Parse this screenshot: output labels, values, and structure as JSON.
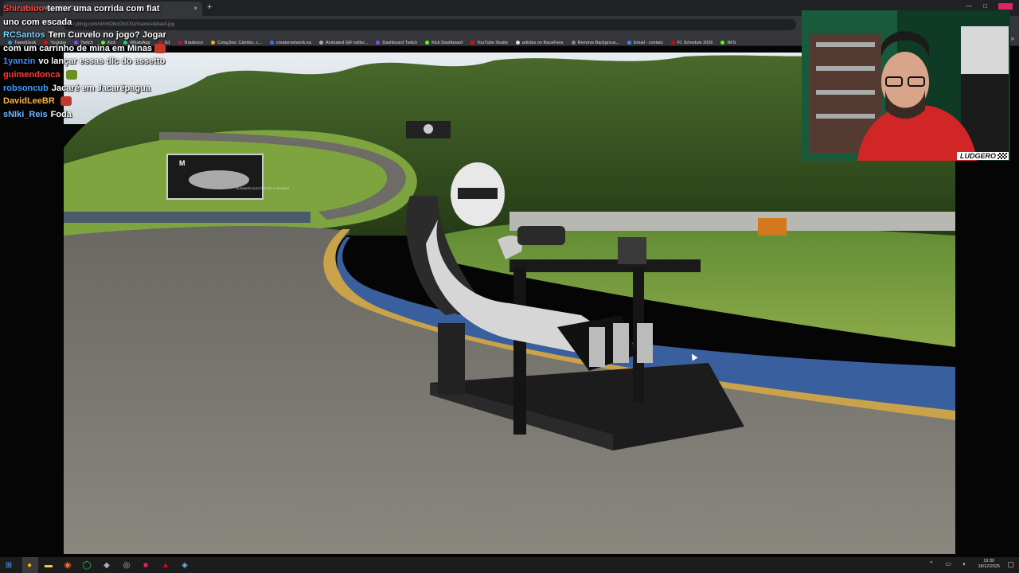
{
  "browser": {
    "tab_title": "i.ytimg.com/vi/... (1280×720)",
    "tab_close": "×",
    "new_tab": "+",
    "url": "i.ytimg.com/vi/nrtObctGhXXU/maxresdefault.jpg",
    "bookmarks": [
      {
        "label": "TweetDeck",
        "color": "#1da1f2"
      },
      {
        "label": "Youtube",
        "color": "#ff0000"
      },
      {
        "label": "Twitch",
        "color": "#9146ff"
      },
      {
        "label": "Kick",
        "color": "#53fc18"
      },
      {
        "label": "WhatsApp",
        "color": "#25d366"
      },
      {
        "label": "G1",
        "color": "#c4170c"
      },
      {
        "label": "Bradesco",
        "color": "#cc092f"
      },
      {
        "label": "Cotações: Câmbio, c...",
        "color": "#f5a623"
      },
      {
        "label": "creatornetwork.ea",
        "color": "#3a6ff7"
      },
      {
        "label": "Animated GIF editor...",
        "color": "#aaaaaa"
      },
      {
        "label": "Dashboard Twitch",
        "color": "#9146ff"
      },
      {
        "label": "Kick Dashboard",
        "color": "#53fc18"
      },
      {
        "label": "YouTube Studio",
        "color": "#ff0000"
      },
      {
        "label": "articles on RaceFans",
        "color": "#dddddd"
      },
      {
        "label": "Remove Backgrous...",
        "color": "#888888"
      },
      {
        "label": "Email - contato",
        "color": "#4285f4"
      },
      {
        "label": "F1 Schedule 2026",
        "color": "#e10600"
      },
      {
        "label": "NFS",
        "color": "#53fc18"
      }
    ]
  },
  "chat": {
    "messages": [
      {
        "user": "Shirubioo",
        "user_color": "#ff4a4a",
        "text": "temer uma corrida com fiat uno com escada",
        "emote": ""
      },
      {
        "user": "RCSantos",
        "user_color": "#7fd1ff",
        "text": "Tem Curvelo no jogo? Jogar com um carrinho de mina em Minas",
        "emote": "#c0392b"
      },
      {
        "user": "1yanzin",
        "user_color": "#4a8cff",
        "text": "vo lançar essas dlc do assetto",
        "emote": ""
      },
      {
        "user": "guimendonca",
        "user_color": "#ff3b3b",
        "text": "",
        "emote": "#6b8e23"
      },
      {
        "user": "robsoncub",
        "user_color": "#3ba0ff",
        "text": "Jacaré em Jacarépagua",
        "emote": ""
      },
      {
        "user": "DavidLeeBR",
        "user_color": "#ffb347",
        "text": "",
        "emote": "#c0392b"
      },
      {
        "user": "sNIki_Reis",
        "user_color": "#6fb6ff",
        "text": "Foda",
        "emote": ""
      }
    ]
  },
  "webcam": {
    "tag": "LUDGERO"
  },
  "game": {
    "billboard_brand": "M",
    "billboard_text": "ULTIMATE ELECTRIFIED M POWER"
  },
  "taskbar": {
    "clock_time": "19:30",
    "clock_date": "18/12/2025",
    "icons": [
      {
        "name": "windows-start-icon",
        "glyph": "⊞",
        "color": "#4aa3ff"
      },
      {
        "name": "chrome-icon",
        "glyph": "●",
        "color": "#f4b400"
      },
      {
        "name": "file-explorer-icon",
        "glyph": "▬",
        "color": "#f4c542"
      },
      {
        "name": "firefox-icon",
        "glyph": "◉",
        "color": "#ff7139"
      },
      {
        "name": "whatsapp-icon",
        "glyph": "◯",
        "color": "#25d366"
      },
      {
        "name": "app-icon",
        "glyph": "◆",
        "color": "#9fb3c8"
      },
      {
        "name": "obs-icon",
        "glyph": "◎",
        "color": "#bbbbbb"
      },
      {
        "name": "app-pink-icon",
        "glyph": "■",
        "color": "#e0245e"
      },
      {
        "name": "app-red-icon",
        "glyph": "▲",
        "color": "#e10600"
      },
      {
        "name": "steam-icon",
        "glyph": "◈",
        "color": "#66c0f4"
      }
    ]
  }
}
